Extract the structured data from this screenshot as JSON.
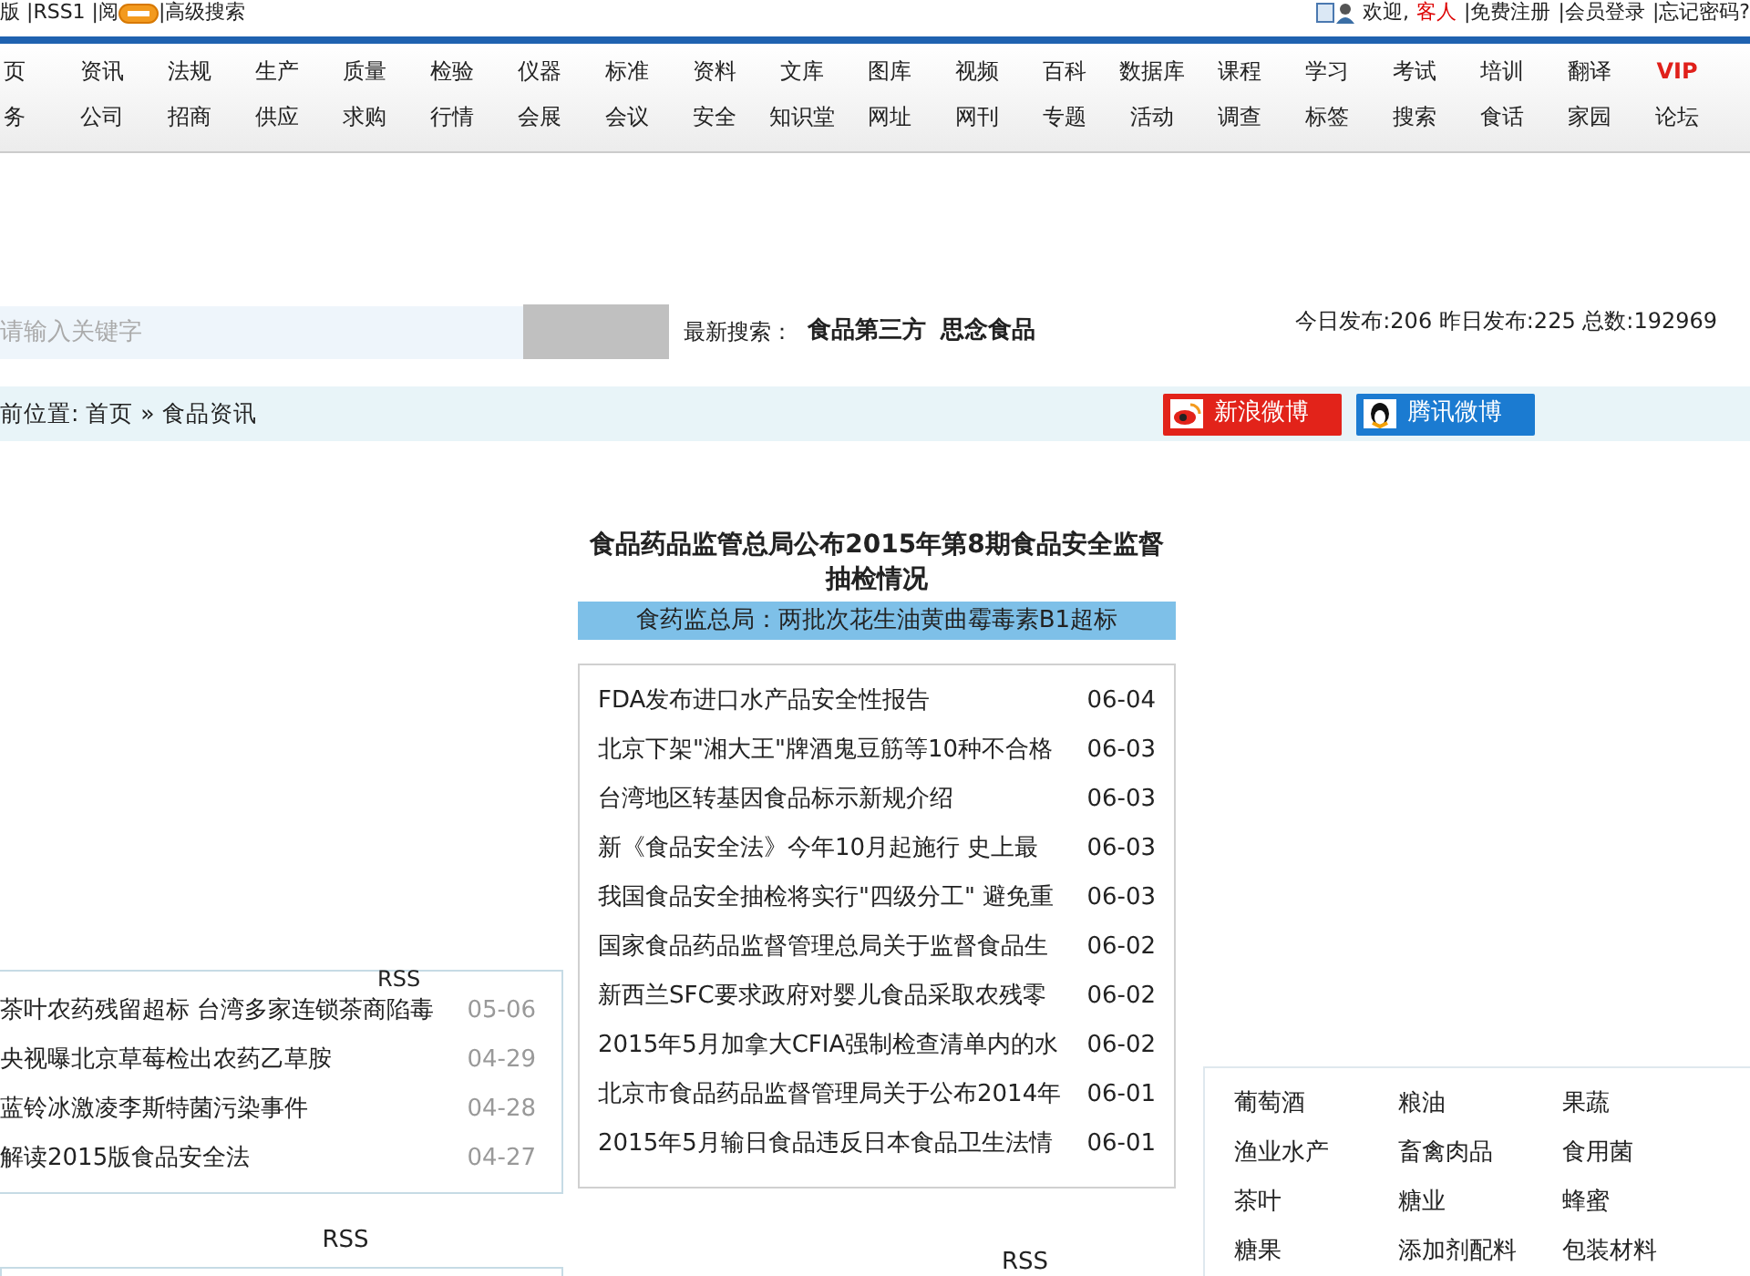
{
  "top_bar": {
    "left": [
      "版 |RSS1 |阅",
      "|高级搜索"
    ],
    "welcome": "欢迎,",
    "guest": "客人",
    "links": [
      "|免费注册",
      "|会员登录",
      "|忘记密码?"
    ]
  },
  "nav": {
    "rows": [
      [
        {
          "label": "页",
          "kind": "link"
        },
        {
          "label": "资讯",
          "kind": "link"
        },
        {
          "label": "法规",
          "kind": "link"
        },
        {
          "label": "生产",
          "kind": "link"
        },
        {
          "label": "质量",
          "kind": "link"
        },
        {
          "label": "检验",
          "kind": "link"
        },
        {
          "label": "仪器",
          "kind": "link"
        },
        {
          "label": "标准",
          "kind": "link"
        },
        {
          "label": "资料",
          "kind": "link"
        },
        {
          "label": "文库",
          "kind": "link"
        },
        {
          "label": "图库",
          "kind": "link"
        },
        {
          "label": "视频",
          "kind": "link"
        },
        {
          "label": "百科",
          "kind": "link"
        },
        {
          "label": "数据库",
          "kind": "link"
        },
        {
          "label": "课程",
          "kind": "link"
        },
        {
          "label": "学习",
          "kind": "link"
        },
        {
          "label": "考试",
          "kind": "link"
        },
        {
          "label": "培训",
          "kind": "link"
        },
        {
          "label": "翻译",
          "kind": "link"
        },
        {
          "label": "VIP",
          "kind": "vip"
        }
      ],
      [
        {
          "label": "务",
          "kind": "link"
        },
        {
          "label": "公司",
          "kind": "link"
        },
        {
          "label": "招商",
          "kind": "link"
        },
        {
          "label": "供应",
          "kind": "link"
        },
        {
          "label": "求购",
          "kind": "link"
        },
        {
          "label": "行情",
          "kind": "link"
        },
        {
          "label": "会展",
          "kind": "link"
        },
        {
          "label": "会议",
          "kind": "link"
        },
        {
          "label": "安全",
          "kind": "link"
        },
        {
          "label": "知识堂",
          "kind": "link"
        },
        {
          "label": "网址",
          "kind": "link"
        },
        {
          "label": "网刊",
          "kind": "link"
        },
        {
          "label": "专题",
          "kind": "link"
        },
        {
          "label": "活动",
          "kind": "link"
        },
        {
          "label": "调查",
          "kind": "link"
        },
        {
          "label": "标签",
          "kind": "link"
        },
        {
          "label": "搜索",
          "kind": "link"
        },
        {
          "label": "食话",
          "kind": "link"
        },
        {
          "label": "家园",
          "kind": "link"
        },
        {
          "label": "论坛",
          "kind": "link"
        }
      ]
    ]
  },
  "search": {
    "placeholder": "请输入关键字",
    "recent_label": "最新搜索：",
    "recent": [
      "食品第三方",
      "思念食品"
    ],
    "stats": "今日发布:206 昨日发布:225 总数:192969"
  },
  "breadcrumb": {
    "text": "前位置: 首页 » 食品资讯",
    "share": [
      {
        "label": "新浪微博",
        "kind": "sina"
      },
      {
        "label": "腾讯微博",
        "kind": "qq"
      }
    ]
  },
  "left_panel": {
    "rss": "RSS",
    "items": [
      {
        "title": "茶叶农药残留超标 台湾多家连锁茶商陷毒",
        "date": "05-06"
      },
      {
        "title": "央视曝北京草莓检出农药乙草胺",
        "date": "04-29"
      },
      {
        "title": "蓝铃冰激凌李斯特菌污染事件",
        "date": "04-28"
      },
      {
        "title": "解读2015版食品安全法",
        "date": "04-27"
      }
    ],
    "rss_below": "RSS"
  },
  "center_panel": {
    "headline": "食品药品监管总局公布2015年第8期食品安全监督抽检情况",
    "subheadline": "食药监总局：两批次花生油黄曲霉毒素B1超标",
    "items": [
      {
        "title": "FDA发布进口水产品安全性报告",
        "date": "06-04"
      },
      {
        "title": "北京下架\"湘大王\"牌酒鬼豆筋等10种不合格",
        "date": "06-03"
      },
      {
        "title": "台湾地区转基因食品标示新规介绍",
        "date": "06-03"
      },
      {
        "title": "新《食品安全法》今年10月起施行 史上最",
        "date": "06-03"
      },
      {
        "title": "我国食品安全抽检将实行\"四级分工\" 避免重",
        "date": "06-03"
      },
      {
        "title": "国家食品药品监督管理总局关于监督食品生",
        "date": "06-02"
      },
      {
        "title": "新西兰SFC要求政府对婴儿食品采取农残零",
        "date": "06-02"
      },
      {
        "title": "2015年5月加拿大CFIA强制检查清单内的水",
        "date": "06-02"
      },
      {
        "title": "北京市食品药品监督管理局关于公布2014年",
        "date": "06-01"
      },
      {
        "title": "2015年5月输日食品违反日本食品卫生法情",
        "date": "06-01"
      }
    ],
    "rss_below": "RSS"
  },
  "right_panel": {
    "categories": [
      "葡萄酒",
      "粮油",
      "果蔬",
      "渔业水产",
      "畜禽肉品",
      "食用菌",
      "茶叶",
      "糖业",
      "蜂蜜",
      "糖果",
      "添加剂配料",
      "包装材料"
    ]
  }
}
